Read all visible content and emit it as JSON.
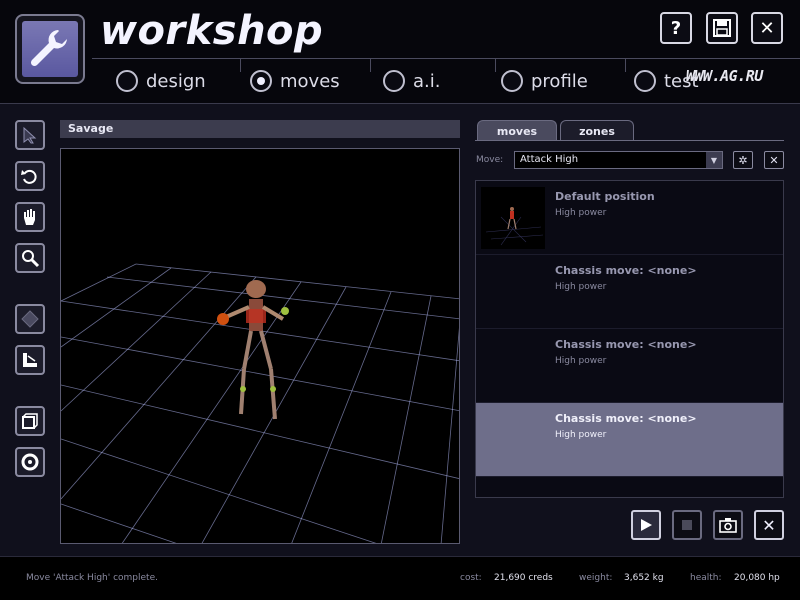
{
  "app": {
    "title": "workshop",
    "watermark": "WWW.AG.RU"
  },
  "header_buttons": {
    "help": "?",
    "close": "✕"
  },
  "nav": {
    "tabs": [
      {
        "label": "design",
        "selected": false
      },
      {
        "label": "moves",
        "selected": true
      },
      {
        "label": "a.i.",
        "selected": false
      },
      {
        "label": "profile",
        "selected": false
      },
      {
        "label": "test",
        "selected": false
      }
    ]
  },
  "tools": [
    {
      "icon": "arrow-pointer-icon"
    },
    {
      "icon": "rotate-icon"
    },
    {
      "icon": "hand-icon"
    },
    {
      "icon": "magnifier-icon"
    },
    {
      "icon": "diamond-icon"
    },
    {
      "icon": "measure-icon"
    },
    {
      "icon": "box-icon"
    },
    {
      "icon": "disc-icon"
    }
  ],
  "viewport": {
    "title": "Savage"
  },
  "panel": {
    "tabs": [
      {
        "label": "moves",
        "selected": true
      },
      {
        "label": "zones",
        "selected": false
      }
    ],
    "move_label": "Move:",
    "move_value": "Attack High",
    "moves": [
      {
        "name": "Default position",
        "sub": "High power",
        "selected": false,
        "has_thumb": true
      },
      {
        "name": "Chassis move: <none>",
        "sub": "High power",
        "selected": false,
        "has_thumb": false
      },
      {
        "name": "Chassis move: <none>",
        "sub": "High power",
        "selected": false,
        "has_thumb": false
      },
      {
        "name": "Chassis move: <none>",
        "sub": "High power",
        "selected": true,
        "has_thumb": false
      }
    ]
  },
  "status": {
    "message": "Move 'Attack High' complete.",
    "cost_label": "cost:",
    "cost_value": "21,690 creds",
    "weight_label": "weight:",
    "weight_value": "3,652 kg",
    "health_label": "health:",
    "health_value": "20,080 hp"
  },
  "colors": {
    "accent": "#6e6e8a",
    "background": "#10101c",
    "grid": "#b8c0ff"
  }
}
